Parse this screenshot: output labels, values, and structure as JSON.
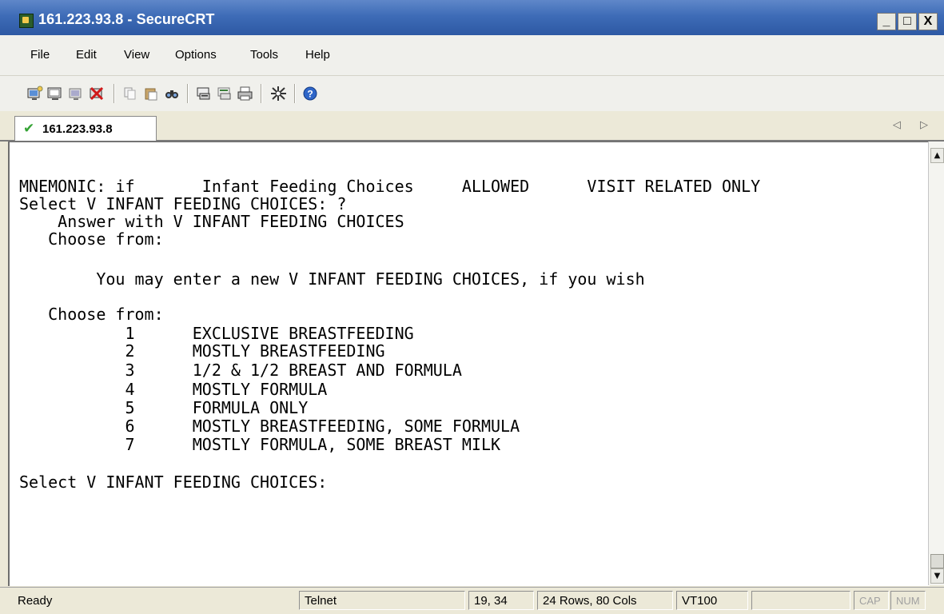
{
  "window": {
    "title": "161.223.93.8 - SecureCRT",
    "minimize": "_",
    "maximize": "□",
    "close": "X"
  },
  "menu": [
    "File",
    "Edit",
    "View",
    "Options",
    "Tools",
    "Help"
  ],
  "toolbar_icons": [
    "connect-icon",
    "quick-connect-icon",
    "reconnect-icon",
    "disconnect-icon",
    "copy-icon",
    "paste-icon",
    "find-icon",
    "print-screen-icon",
    "print-selection-icon",
    "print-icon",
    "settings-icon",
    "help-icon"
  ],
  "tab": {
    "check": "✔",
    "label": "161.223.93.8",
    "nav": "◁ ▷"
  },
  "terminal": {
    "lines": [
      "MNEMONIC: if       Infant Feeding Choices     ALLOWED      VISIT RELATED ONLY",
      "Select V INFANT FEEDING CHOICES: ?",
      "    Answer with V INFANT FEEDING CHOICES",
      "   Choose from:",
      "",
      "        You may enter a new V INFANT FEEDING CHOICES, if you wish",
      "",
      "   Choose from:",
      "           1      EXCLUSIVE BREASTFEEDING",
      "           2      MOSTLY BREASTFEEDING",
      "           3      1/2 & 1/2 BREAST AND FORMULA",
      "           4      MOSTLY FORMULA",
      "           5      FORMULA ONLY",
      "           6      MOSTLY BREASTFEEDING, SOME FORMULA",
      "           7      MOSTLY FORMULA, SOME BREAST MILK",
      "",
      "Select V INFANT FEEDING CHOICES:"
    ]
  },
  "status": {
    "ready": "Ready",
    "protocol": "Telnet",
    "cursor": "19, 34",
    "size": "24 Rows, 80 Cols",
    "emulation": "VT100",
    "blank": "",
    "cap": "CAP",
    "num": "NUM"
  }
}
